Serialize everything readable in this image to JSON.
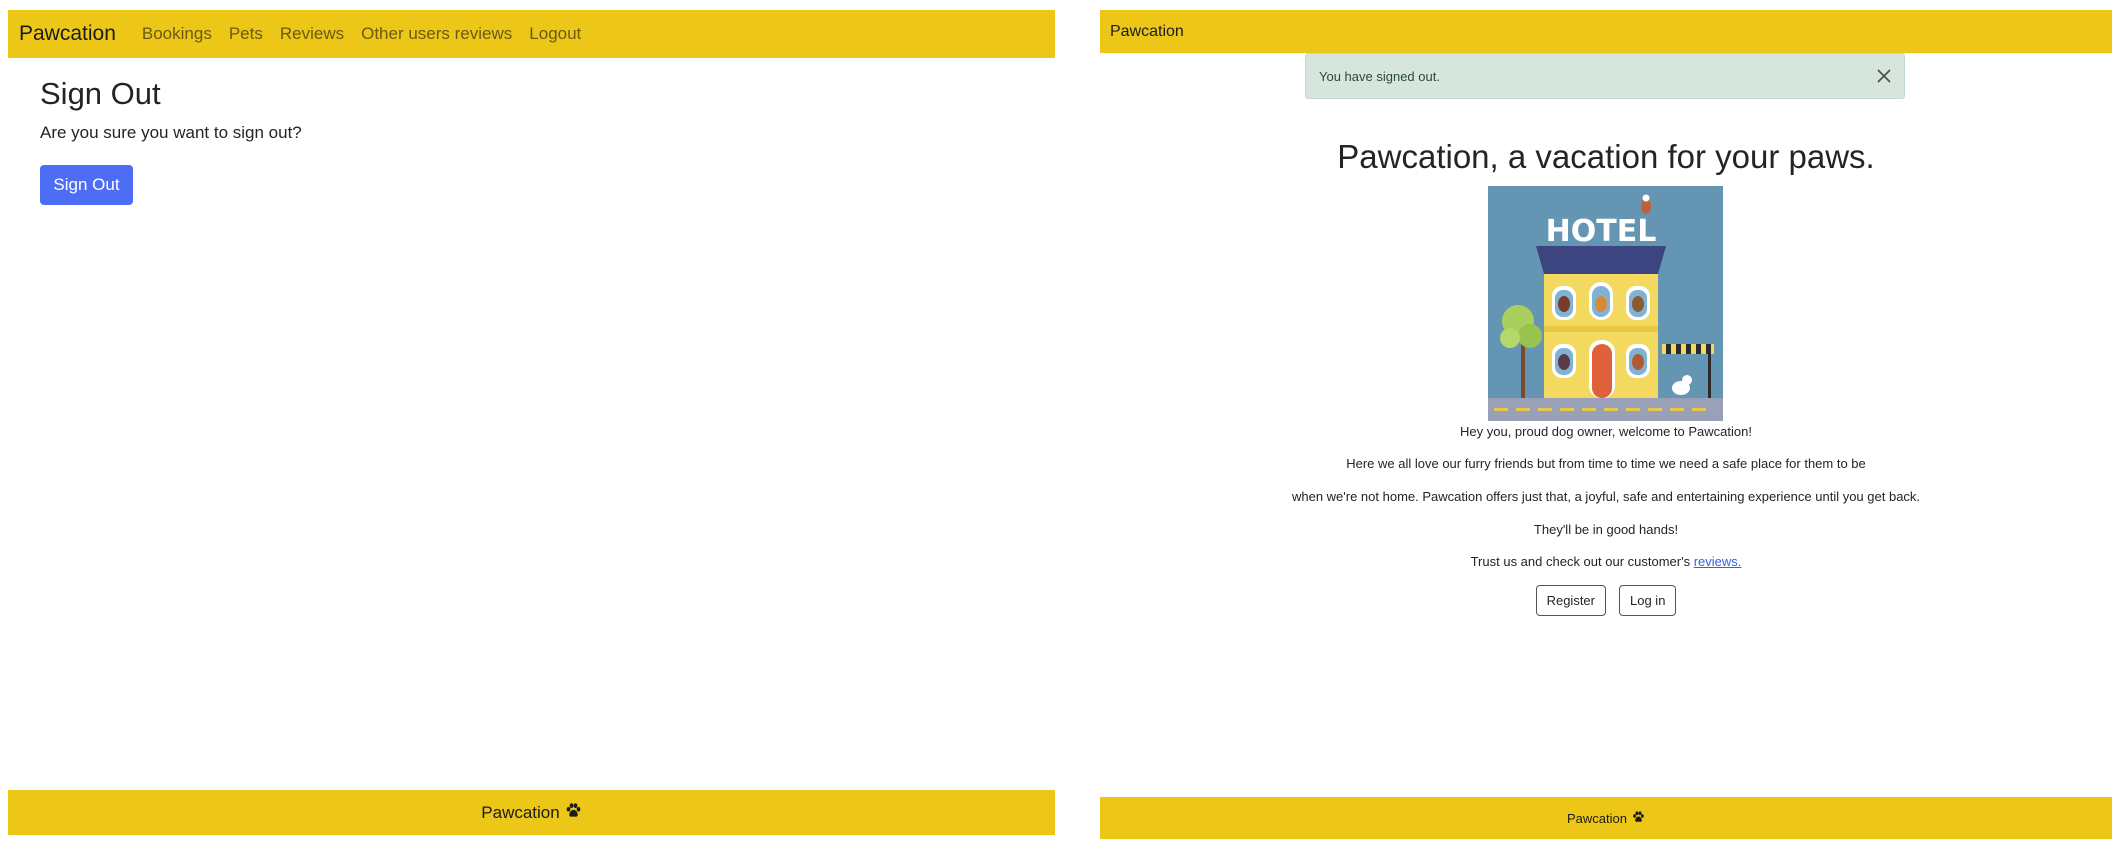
{
  "left": {
    "navbar": {
      "brand": "Pawcation",
      "links": [
        "Bookings",
        "Pets",
        "Reviews",
        "Other users reviews",
        "Logout"
      ]
    },
    "title": "Sign Out",
    "question": "Are you sure you want to sign out?",
    "button_label": "Sign Out",
    "footer_text": "Pawcation"
  },
  "right": {
    "navbar": {
      "brand": "Pawcation"
    },
    "alert_text": "You have signed out.",
    "hero_title": "Pawcation, a vacation for your paws.",
    "image": {
      "sign_text": "HOTEL"
    },
    "lines": [
      "Hey you, proud dog owner, welcome to Pawcation!",
      "Here we all love our furry friends but from time to time we need a safe place for them to be",
      "when we're not home. Pawcation offers just that, a joyful, safe and entertaining experience until you get back.",
      "They'll be in good hands!"
    ],
    "trust_prefix": "Trust us and check out our customer's ",
    "reviews_link": "reviews.",
    "register_label": "Register",
    "login_label": "Log in",
    "footer_text": "Pawcation"
  },
  "colors": {
    "navbar": "#ecc718",
    "primary_button": "#4e6df5",
    "alert_bg": "#d6e6dd",
    "link": "#3860e0"
  },
  "icons": [
    "paw-icon",
    "close-icon"
  ]
}
